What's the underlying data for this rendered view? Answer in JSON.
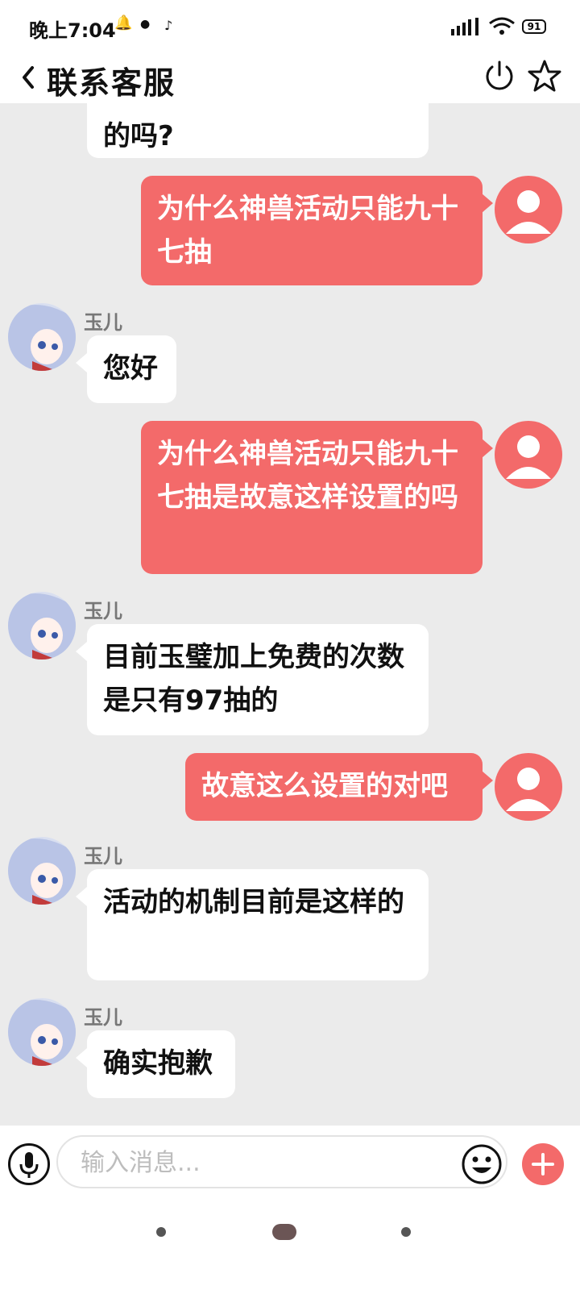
{
  "status_bar": {
    "time": "晚上7:04",
    "battery": "91"
  },
  "header": {
    "title": "联系客服"
  },
  "messages": [
    {
      "sender": "agent",
      "text": "的吗?"
    },
    {
      "sender": "user",
      "text": "为什么神兽活动只能九十七抽"
    },
    {
      "sender": "agent",
      "name": "玉儿",
      "text": "您好"
    },
    {
      "sender": "user",
      "text": "为什么神兽活动只能九十七抽是故意这样设置的吗"
    },
    {
      "sender": "agent",
      "name": "玉儿",
      "text": "目前玉璧加上免费的次数是只有97抽的"
    },
    {
      "sender": "user",
      "text": "故意这么设置的对吧"
    },
    {
      "sender": "agent",
      "name": "玉儿",
      "text": "活动的机制目前是这样的"
    },
    {
      "sender": "agent",
      "name": "玉儿",
      "text": "确实抱歉"
    }
  ],
  "input": {
    "placeholder": "输入消息..."
  },
  "colors": {
    "accent": "#f36a6a",
    "chat_bg": "#ebebeb"
  }
}
